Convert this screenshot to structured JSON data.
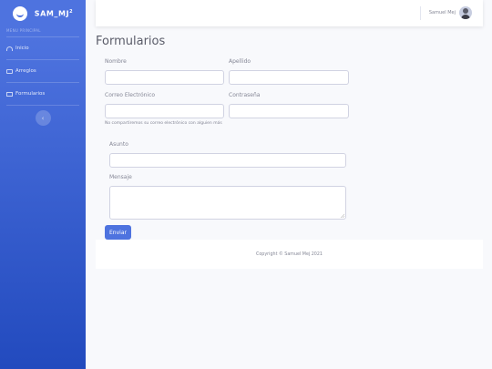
{
  "sidebar": {
    "brand": "SAM_MJ",
    "brand_sup": "2",
    "heading": "MENU PRINCIPAL",
    "items": [
      {
        "label": "Inicio",
        "icon": "gauge-icon"
      },
      {
        "label": "Arreglos",
        "icon": "wrench-icon"
      },
      {
        "label": "Formularios",
        "icon": "table-icon"
      }
    ],
    "toggle_icon": "‹"
  },
  "topbar": {
    "user_name": "Samuel Mej"
  },
  "main": {
    "title": "Formularios",
    "form": {
      "nombre_label": "Nombre",
      "nombre_value": "",
      "apellido_label": "Apellido",
      "apellido_value": "",
      "email_label": "Correo Electrónico",
      "email_value": "",
      "email_help": "No compartiremos su correo electrónico con alguien más",
      "password_label": "Contraseña",
      "password_value": "",
      "asunto_label": "Asunto",
      "asunto_value": "",
      "mensaje_label": "Mensaje",
      "mensaje_value": "",
      "submit_label": "Enviar"
    }
  },
  "footer": {
    "text": "Copyright © Samuel Mej 2021"
  },
  "colors": {
    "primary": "#4e73df",
    "sidebar_bottom": "#224abe",
    "background": "#f8f9fc"
  }
}
